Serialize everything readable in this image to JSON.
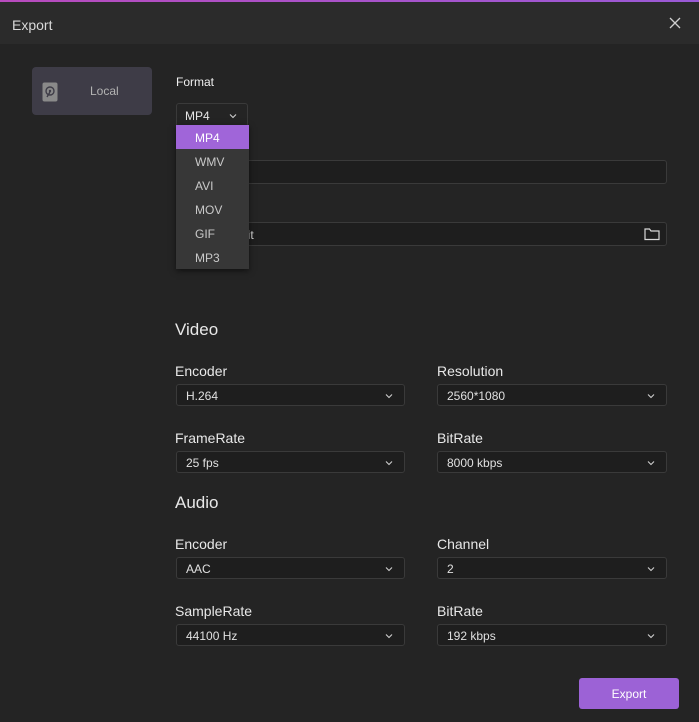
{
  "window": {
    "title": "Export"
  },
  "sidebar": {
    "local_label": "Local"
  },
  "format": {
    "label": "Format",
    "selected": "MP4",
    "options": [
      "MP4",
      "WMV",
      "AVI",
      "MOV",
      "GIF",
      "MP3"
    ]
  },
  "path": {
    "visible_fragment": "lit"
  },
  "video": {
    "heading": "Video",
    "encoder": {
      "label": "Encoder",
      "value": "H.264"
    },
    "resolution": {
      "label": "Resolution",
      "value": "2560*1080"
    },
    "framerate": {
      "label": "FrameRate",
      "value": "25 fps"
    },
    "bitrate": {
      "label": "BitRate",
      "value": "8000 kbps"
    }
  },
  "audio": {
    "heading": "Audio",
    "encoder": {
      "label": "Encoder",
      "value": "AAC"
    },
    "channel": {
      "label": "Channel",
      "value": "2"
    },
    "samplerate": {
      "label": "SampleRate",
      "value": "44100 Hz"
    },
    "bitrate": {
      "label": "BitRate",
      "value": "192 kbps"
    }
  },
  "actions": {
    "export_label": "Export"
  },
  "colors": {
    "accent": "#9c62d6",
    "background": "#242424",
    "titlebar": "#2b2b2b"
  },
  "icons": {
    "close": "close-icon",
    "disk": "hard-disk-icon",
    "folder": "folder-icon",
    "chevron": "chevron-down-icon"
  }
}
